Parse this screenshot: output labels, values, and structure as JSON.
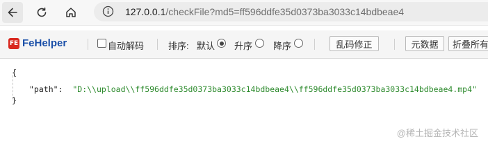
{
  "browser": {
    "url_host": "127.0.0.1",
    "url_path": "/checkFile?md5=ff596ddfe35d0373ba3033c14bdbeae4"
  },
  "toolbar": {
    "logo_text": "FE",
    "app_name": "FeHelper",
    "auto_decode_label": "自动解码",
    "sort_label": "排序:",
    "sort_default_label": "默认",
    "sort_asc_label": "升序",
    "sort_desc_label": "降序",
    "sort_selected": "默认",
    "fix_garbled_label": "乱码修正",
    "metadata_label": "元数据",
    "collapse_all_label": "折叠所有"
  },
  "json": {
    "open_brace": "{",
    "close_brace": "}",
    "key": "\"path\"",
    "colon": ":",
    "value": "\"D:\\\\upload\\\\ff596ddfe35d0373ba3033c14bdbeae4\\\\ff596ddfe35d0373ba3033c14bdbeae4.mp4\""
  },
  "watermark": "@稀土掘金技术社区"
}
